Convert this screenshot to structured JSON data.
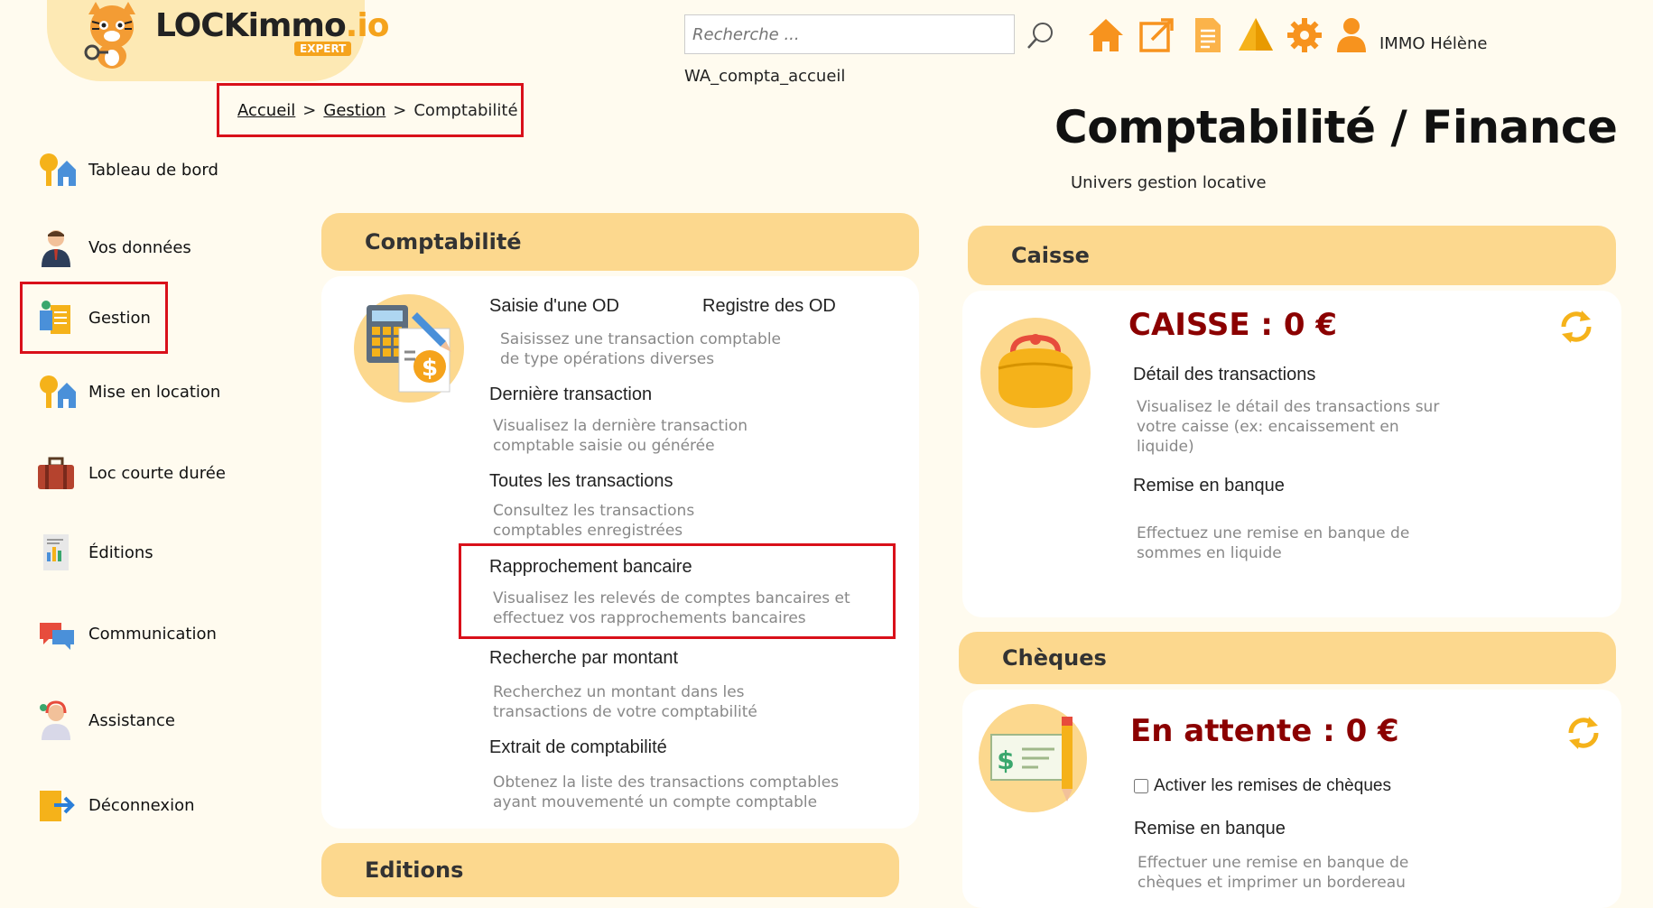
{
  "brand": {
    "name": "LOCKimmo",
    "suffix": ".io",
    "badge": "EXPERT",
    "accent": "#f5a31c"
  },
  "breadcrumb": [
    {
      "label": "Accueil"
    },
    {
      "label": "Gestion"
    },
    {
      "label": "Comptabilité"
    }
  ],
  "breadcrumb_sep": ">",
  "search": {
    "placeholder": "Recherche ..."
  },
  "page_code": "WA_compta_accueil",
  "toolbar_icons": [
    "home-icon",
    "edit-external-icon",
    "document-icon",
    "alert-triangle-icon",
    "settings-gear-icon",
    "user-icon"
  ],
  "user_name": "IMMO Hélène",
  "page_title": "Comptabilité / Finance",
  "page_subtitle": "Univers gestion locative",
  "sidebar": {
    "items": [
      {
        "label": "Tableau de bord",
        "icon": "dashboard-key-house-icon"
      },
      {
        "label": "Vos données",
        "icon": "person-icon"
      },
      {
        "label": "Gestion",
        "icon": "management-icon"
      },
      {
        "label": "Mise en location",
        "icon": "rental-key-house-icon"
      },
      {
        "label": "Loc courte durée",
        "icon": "suitcase-icon"
      },
      {
        "label": "Éditions",
        "icon": "report-icon"
      },
      {
        "label": "Communication",
        "icon": "chat-bubbles-icon"
      },
      {
        "label": "Assistance",
        "icon": "support-agent-icon"
      },
      {
        "label": "Déconnexion",
        "icon": "logout-icon"
      }
    ]
  },
  "compta": {
    "title": "Comptabilité",
    "links": {
      "saisie": "Saisie d'une OD",
      "registre": "Registre des OD",
      "saisie_desc1": "Saisissez une transaction comptable",
      "saisie_desc2": "de type opérations diverses",
      "derniere": "Dernière transaction",
      "derniere_desc1": "Visualisez la dernière transaction",
      "derniere_desc2": "comptable saisie ou générée",
      "toutes": "Toutes les transactions",
      "toutes_desc1": "Consultez les transactions",
      "toutes_desc2": "comptables enregistrées",
      "rappro": "Rapprochement bancaire",
      "rappro_desc1": "Visualisez les relevés de comptes bancaires et",
      "rappro_desc2": "effectuez vos rapprochements bancaires",
      "recherche": "Recherche par montant",
      "recherche_desc1": "Recherchez un montant dans les",
      "recherche_desc2": "transactions de votre comptabilité",
      "extrait": "Extrait de comptabilité",
      "extrait_desc1": "Obtenez la liste des transactions comptables",
      "extrait_desc2": "ayant mouvementé un compte comptable"
    }
  },
  "editions": {
    "title": "Editions"
  },
  "caisse": {
    "title": "Caisse",
    "amount": "CAISSE : 0 €",
    "detail": "Détail des transactions",
    "detail_desc1": "Visualisez le détail des transactions sur",
    "detail_desc2": "votre caisse (ex: encaissement en",
    "detail_desc3": "liquide)",
    "remise": "Remise en banque",
    "remise_desc1": "Effectuez une remise en banque de",
    "remise_desc2": "sommes en liquide"
  },
  "cheques": {
    "title": "Chèques",
    "amount": "En attente : 0 €",
    "checkbox_label": "Activer les remises de chèques",
    "checkbox_checked": false,
    "remise": "Remise en banque",
    "remise_desc1": "Effectuer une remise en banque de",
    "remise_desc2": "chèques et imprimer un bordereau"
  },
  "colors": {
    "panel_header": "#fcd88e",
    "background": "#fffbef",
    "amount_red": "#8b0000",
    "highlight_red": "#d9101a"
  }
}
